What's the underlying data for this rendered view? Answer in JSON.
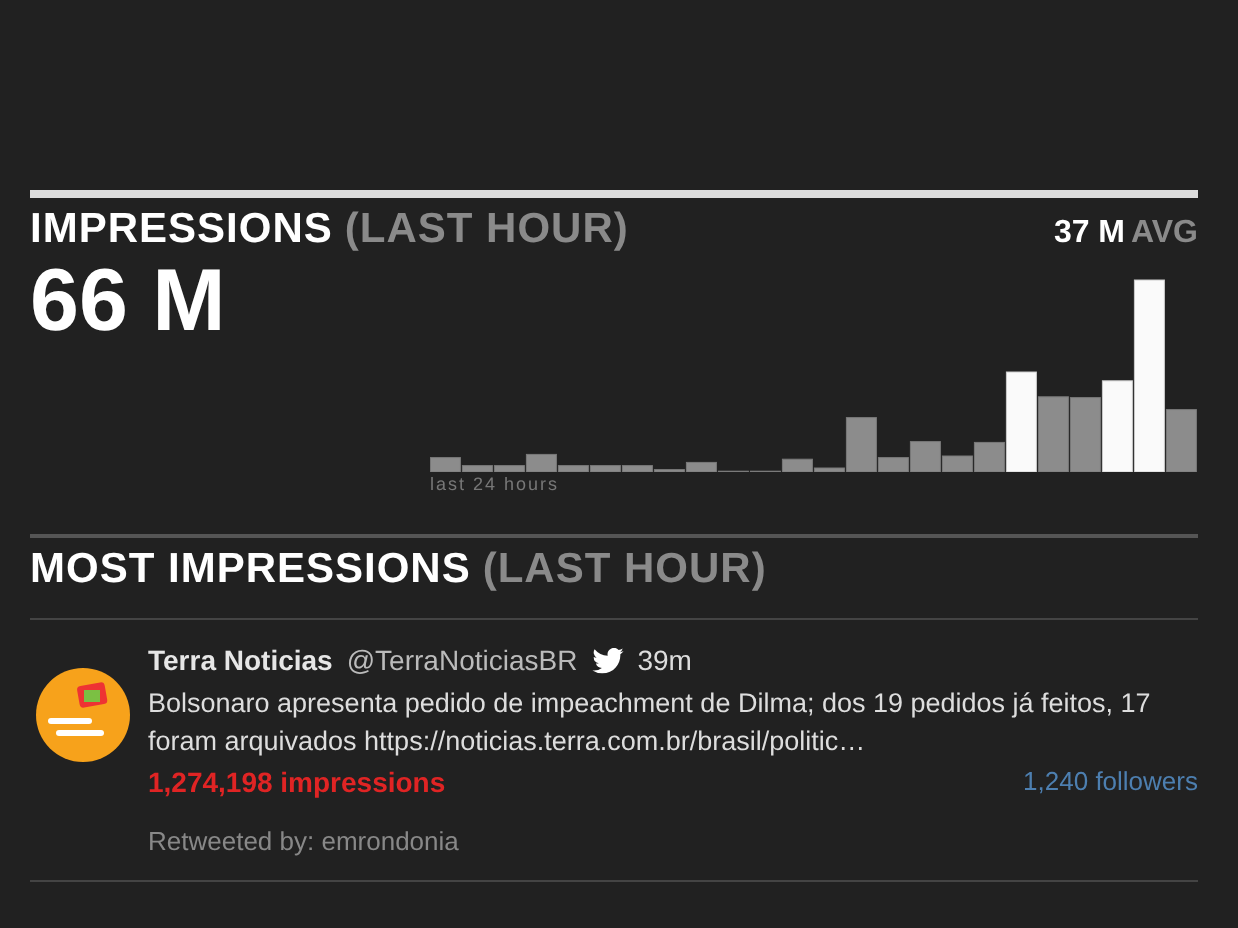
{
  "impressions": {
    "title": "IMPRESSIONS",
    "qualifier": "(LAST HOUR)",
    "average": "37 M",
    "average_label": "AVG",
    "total": "66 M",
    "chart_caption": "last 24 hours"
  },
  "most_impressions": {
    "title": "MOST IMPRESSIONS",
    "qualifier": "(LAST HOUR)",
    "tweets": [
      {
        "name": "Terra Noticias",
        "handle": "@TerraNoticiasBR",
        "time": "39m",
        "text": "Bolsonaro apresenta pedido de impeachment de Dilma; dos 19 pedidos já feitos, 17 foram arquivados https://noticias.terra.com.br/brasil/politic…",
        "impressions": "1,274,198 impressions",
        "followers": "1,240 followers",
        "retweeted_by": "Retweeted by: emrondonia"
      }
    ]
  }
}
